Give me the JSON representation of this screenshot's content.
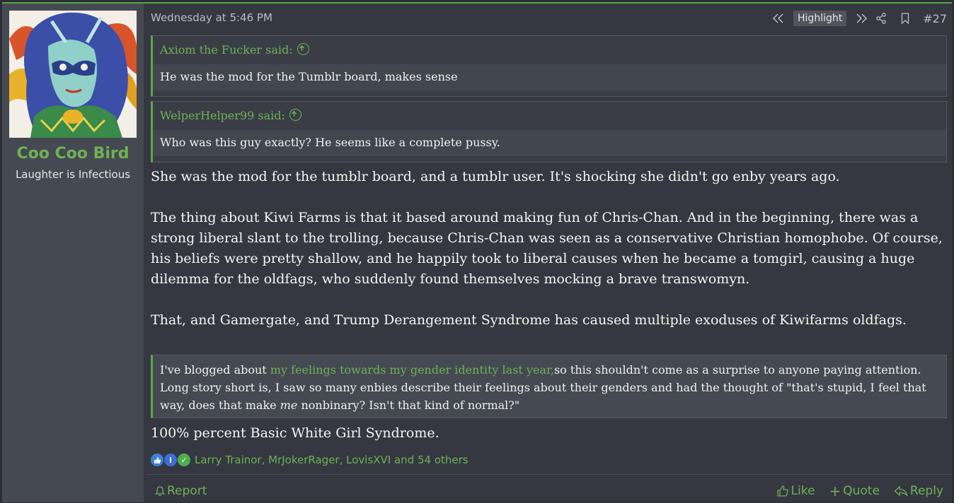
{
  "user": {
    "name": "Coo Coo Bird",
    "title": "Laughter is Infectious"
  },
  "post": {
    "date": "Wednesday at 5:46 PM",
    "highlight_label": "Highlight",
    "number": "#27",
    "quotes": [
      {
        "author": "Axiom the Fucker said:",
        "text": "He was the mod for the Tumblr board, makes sense"
      },
      {
        "author": "WelperHelper99 said:",
        "text": "Who was this guy exactly? He seems like a complete pussy."
      }
    ],
    "paragraphs": [
      "She was the mod for the tumblr board, and a tumblr user. It's shocking she didn't go enby years ago.",
      "The thing about Kiwi Farms is that it based around making fun of Chris-Chan. And in the beginning, there was a strong liberal slant to the trolling, because Chris-Chan was seen as a conservative Christian homophobe. Of course, his beliefs were pretty shallow, and he happily took to liberal causes when he became a tomgirl, causing a huge dilemma for the oldfags, who suddenly found themselves mocking a brave transwomyn.",
      "That, and Gamergate, and Trump Derangement Syndrome has caused multiple exoduses of Kiwifarms oldfags."
    ],
    "signature": {
      "before_link": "I've blogged about ",
      "link": "my feelings towards my gender identity last year,",
      "after_link": "so this shouldn't come as a surprise to anyone paying attention. Long story short is, I saw so many enbies describe their feelings about their genders and had the thought of \"that's stupid, I feel that way, does that make ",
      "emphasis": "me",
      "end": " nonbinary? Isn't that kind of normal?\""
    },
    "tail": "100% percent Basic White Girl Syndrome.",
    "reactions": "Larry Trainor, MrJokerRager, LovisXVI and 54 others"
  },
  "footer": {
    "report": "Report",
    "like": "Like",
    "quote": "Quote",
    "reply": "Reply"
  },
  "colors": {
    "accent": "#6fb155",
    "background": "#353840",
    "sidebar": "#454a52"
  }
}
